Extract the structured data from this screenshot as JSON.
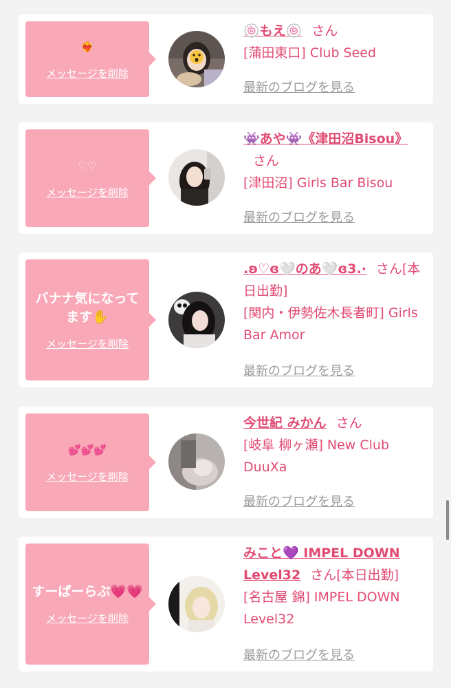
{
  "common": {
    "delete_label": "メッセージを削除",
    "blog_label": "最新のブログを見る",
    "san_label": "さん"
  },
  "entries": [
    {
      "message": "❤️‍🔥",
      "name": "🍥もえ🍥",
      "suffix": "",
      "shop": "[蒲田東口] Club Seed"
    },
    {
      "message": "♡♡",
      "name": "👾あや👾《津田沼Bisou》",
      "suffix": "",
      "shop": "[津田沼] Girls Bar Bisou"
    },
    {
      "message": "バナナ気になってます✋",
      "name": ".ʚ♡ɞ🤍のあ🤍ɞ3.·",
      "suffix": "[本日出勤]",
      "shop": "[関内・伊勢佐木長者町] Girls Bar Amor"
    },
    {
      "message": "💕💕💕",
      "name": "今世紀 みかん",
      "suffix": "",
      "shop": "[岐阜 柳ヶ瀬] New Club DuuXa"
    },
    {
      "message": "すーぱーらぶ💗💗",
      "name": "みこと💜 IMPEL DOWN Level32",
      "suffix": "[本日出勤]",
      "shop": "[名古屋 錦] IMPEL DOWN Level32"
    }
  ],
  "colors": {
    "page_bg": "#f4f3f3",
    "bubble_bg": "#f9a8b8",
    "accent_pink": "#e14a72",
    "muted_link": "#9a9a9a"
  }
}
